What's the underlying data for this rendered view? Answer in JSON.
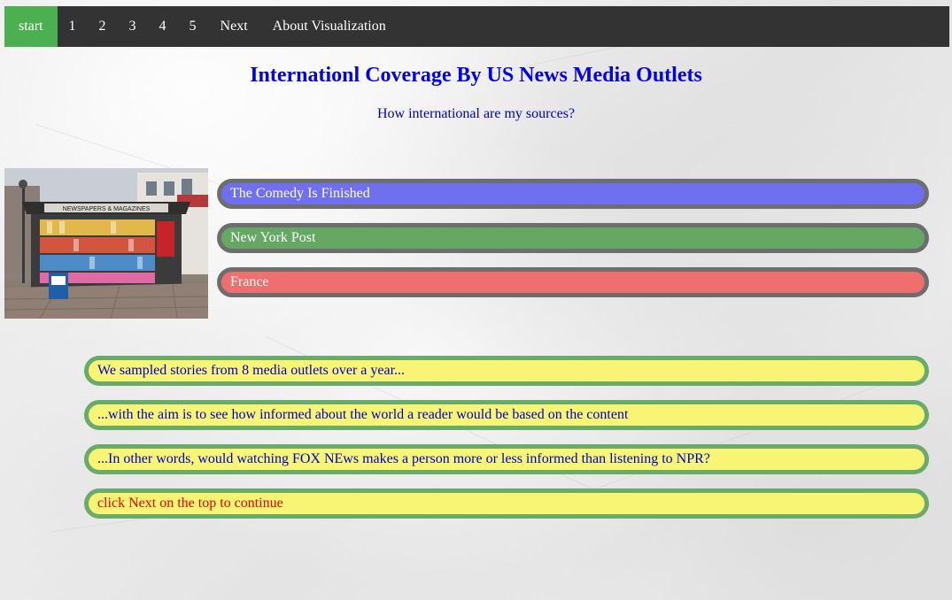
{
  "nav": {
    "items": [
      "start",
      "1",
      "2",
      "3",
      "4",
      "5",
      "Next",
      "About Visualization"
    ],
    "active": "start"
  },
  "header": {
    "title": "Internationl Coverage By US News Media Outlets",
    "subtitle": "How international are my sources?"
  },
  "legend_pills": [
    {
      "label": "The Comedy Is Finished",
      "color": "#6f6ff0"
    },
    {
      "label": "New York Post",
      "color": "#64a864"
    },
    {
      "label": "France",
      "color": "#ef6e6e"
    }
  ],
  "story_pills": [
    {
      "text": "We sampled stories from 8 media outlets over a year...",
      "text_color": "#0000cc"
    },
    {
      "text": "...with the aim is to see how informed about the world a reader would be based on the content",
      "text_color": "#0000cc"
    },
    {
      "text": "...In other words, would watching FOX NEws makes a person more or less informed than listening to NPR?",
      "text_color": "#0000cc"
    },
    {
      "text": "click Next on the top to continue",
      "text_color": "#ee0000"
    }
  ],
  "colors": {
    "navbar_bg": "#333333",
    "nav_active": "#4caf50",
    "story_pill_bg": "#f7f573",
    "story_pill_border": "#6aaa6a",
    "legend_pill_border": "#6e6e6e"
  },
  "photo": {
    "sign_text": "NEWSPAPERS & MAGAZINES"
  }
}
